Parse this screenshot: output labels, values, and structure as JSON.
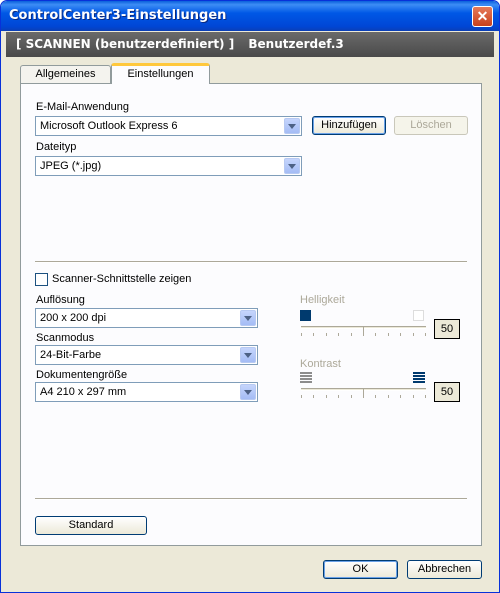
{
  "window": {
    "title": "ControlCenter3-Einstellungen",
    "close_glyph": "✕"
  },
  "header": {
    "mode": "[ SCANNEN (benutzerdefiniert) ]",
    "name": "Benutzerdef.3"
  },
  "tabs": [
    {
      "label": "Allgemeines",
      "active": false
    },
    {
      "label": "Einstellungen",
      "active": true
    }
  ],
  "email": {
    "label": "E-Mail-Anwendung",
    "value": "Microsoft Outlook Express 6",
    "add_label": "Hinzufügen",
    "delete_label": "Löschen"
  },
  "filetype": {
    "label": "Dateityp",
    "value": "JPEG (*.jpg)"
  },
  "scanner_ui": {
    "label": "Scanner-Schnittstelle zeigen",
    "checked": false
  },
  "resolution": {
    "label": "Auflösung",
    "value": "200 x 200 dpi"
  },
  "scanmode": {
    "label": "Scanmodus",
    "value": "24-Bit-Farbe"
  },
  "docsize": {
    "label": "Dokumentengröße",
    "value": "A4 210 x 297 mm"
  },
  "brightness": {
    "label": "Helligkeit",
    "value": "50",
    "level": 0.5,
    "enabled": false
  },
  "contrast": {
    "label": "Kontrast",
    "value": "50",
    "level": 0.5,
    "enabled": false
  },
  "buttons": {
    "standard": "Standard",
    "ok": "OK",
    "cancel": "Abbrechen"
  },
  "colors": {
    "title_blue": "#0054e3",
    "dialog_bg": "#ece9d8",
    "tab_highlight": "#ffc83c"
  }
}
